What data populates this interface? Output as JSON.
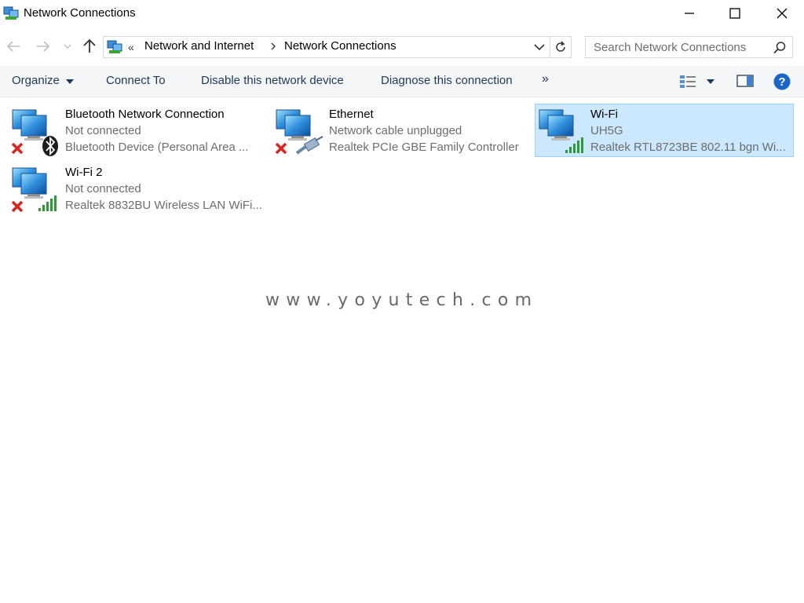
{
  "window": {
    "title": "Network Connections"
  },
  "address_bar": {
    "overflow_chevron": "«",
    "breadcrumbs": [
      "Network and Internet",
      "Network Connections"
    ]
  },
  "search": {
    "placeholder": "Search Network Connections"
  },
  "command_bar": {
    "organize": "Organize",
    "connect_to": "Connect To",
    "disable": "Disable this network device",
    "diagnose": "Diagnose this connection",
    "more": "»"
  },
  "connections": [
    {
      "name": "Bluetooth Network Connection",
      "status": "Not connected",
      "device": "Bluetooth Device (Personal Area ...",
      "overlay": "bluetooth-icon",
      "disconnected": true,
      "selected": false
    },
    {
      "name": "Ethernet",
      "status": "Network cable unplugged",
      "device": "Realtek PCIe GBE Family Controller",
      "overlay": "ethernet-cable-icon",
      "disconnected": true,
      "selected": false
    },
    {
      "name": "Wi-Fi",
      "status": "UH5G",
      "device": "Realtek RTL8723BE 802.11 bgn Wi...",
      "overlay": "signal-bars-icon",
      "disconnected": false,
      "selected": true
    },
    {
      "name": "Wi-Fi 2",
      "status": "Not connected",
      "device": "Realtek 8832BU Wireless LAN WiFi...",
      "overlay": "signal-bars-icon",
      "disconnected": true,
      "selected": false
    }
  ],
  "watermark": "www.yoyutech.com",
  "colors": {
    "selection_bg": "#cce8ff",
    "selection_border": "#99d1ff",
    "command_text": "#1e395b",
    "help_blue": "#1a66c7",
    "error_red": "#d9231e",
    "signal_green": "#2e9a35"
  }
}
